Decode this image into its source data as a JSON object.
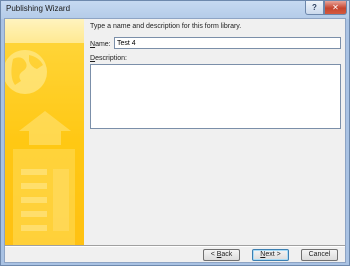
{
  "window": {
    "title": "Publishing Wizard",
    "help_glyph": "?",
    "close_glyph": "✕"
  },
  "wizard": {
    "instruction": "Type a name and description for this form library.",
    "name_label_key": "N",
    "name_label_rest": "ame:",
    "name_value": "Test 4",
    "description_label_key": "D",
    "description_label_rest": "escription:",
    "description_value": ""
  },
  "buttons": {
    "back_prefix": "< ",
    "back_key": "B",
    "back_rest": "ack",
    "next_key": "N",
    "next_rest": "ext >",
    "cancel": "Cancel"
  },
  "colors": {
    "art_yellow": "#ffc813",
    "title_bar": "#b4cbe8"
  },
  "icons": {
    "globe": "globe-icon",
    "arrow": "up-arrow-icon",
    "document": "form-document-icon"
  }
}
